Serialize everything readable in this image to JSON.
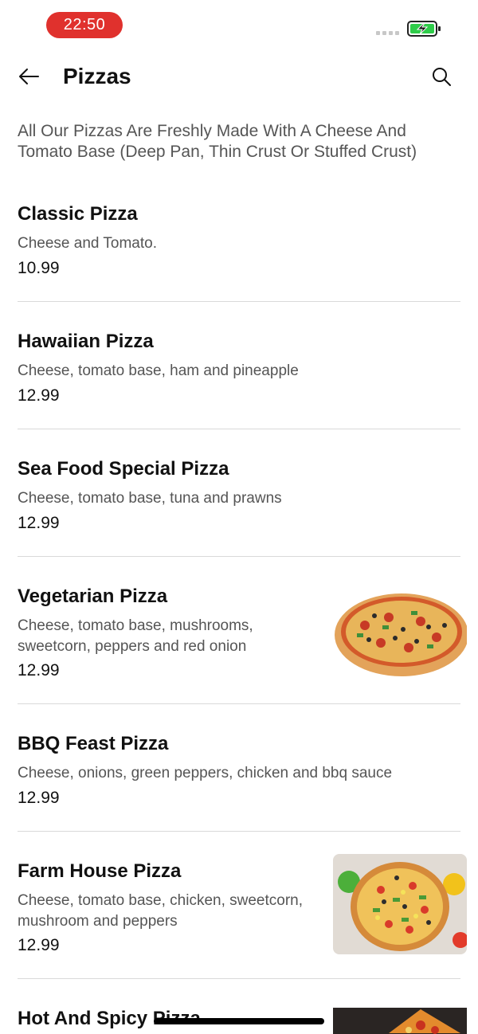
{
  "status_bar": {
    "time": "22:50",
    "battery_icon": "battery-charging-icon",
    "time_pill_color": "#e0312d",
    "battery_color": "#2fcc4a"
  },
  "header": {
    "title": "Pizzas",
    "back_icon": "arrow-left-icon",
    "search_icon": "search-icon"
  },
  "intro_text": "All Our Pizzas Are Freshly Made With A Cheese And Tomato Base (Deep Pan, Thin Crust Or Stuffed Crust)",
  "items": [
    {
      "name": "Classic Pizza",
      "description": "Cheese and Tomato.",
      "price": "10.99"
    },
    {
      "name": "Hawaiian Pizza",
      "description": "Cheese, tomato base, ham and pineapple",
      "price": "12.99"
    },
    {
      "name": "Sea Food Special Pizza",
      "description": "Cheese, tomato base, tuna and prawns",
      "price": "12.99"
    },
    {
      "name": "Vegetarian Pizza",
      "description": "Cheese, tomato base, mushrooms, sweetcorn, peppers and red onion",
      "price": "12.99"
    },
    {
      "name": "BBQ Feast Pizza",
      "description": "Cheese, onions, green peppers, chicken and bbq sauce",
      "price": "12.99"
    },
    {
      "name": "Farm House Pizza",
      "description": "Cheese, tomato base, chicken, sweetcorn, mushroom and peppers",
      "price": "12.99"
    },
    {
      "name": "Hot And Spicy Pizza"
    }
  ]
}
